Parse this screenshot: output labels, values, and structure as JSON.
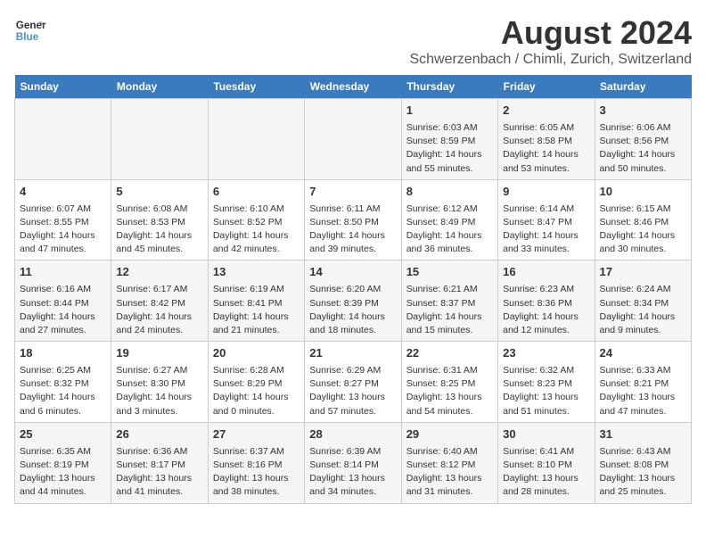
{
  "logo": {
    "line1": "General",
    "line2": "Blue"
  },
  "title": "August 2024",
  "subtitle": "Schwerzenbach / Chimli, Zurich, Switzerland",
  "days_of_week": [
    "Sunday",
    "Monday",
    "Tuesday",
    "Wednesday",
    "Thursday",
    "Friday",
    "Saturday"
  ],
  "weeks": [
    [
      {
        "day": "",
        "content": ""
      },
      {
        "day": "",
        "content": ""
      },
      {
        "day": "",
        "content": ""
      },
      {
        "day": "",
        "content": ""
      },
      {
        "day": "1",
        "content": "Sunrise: 6:03 AM\nSunset: 8:59 PM\nDaylight: 14 hours\nand 55 minutes."
      },
      {
        "day": "2",
        "content": "Sunrise: 6:05 AM\nSunset: 8:58 PM\nDaylight: 14 hours\nand 53 minutes."
      },
      {
        "day": "3",
        "content": "Sunrise: 6:06 AM\nSunset: 8:56 PM\nDaylight: 14 hours\nand 50 minutes."
      }
    ],
    [
      {
        "day": "4",
        "content": "Sunrise: 6:07 AM\nSunset: 8:55 PM\nDaylight: 14 hours\nand 47 minutes."
      },
      {
        "day": "5",
        "content": "Sunrise: 6:08 AM\nSunset: 8:53 PM\nDaylight: 14 hours\nand 45 minutes."
      },
      {
        "day": "6",
        "content": "Sunrise: 6:10 AM\nSunset: 8:52 PM\nDaylight: 14 hours\nand 42 minutes."
      },
      {
        "day": "7",
        "content": "Sunrise: 6:11 AM\nSunset: 8:50 PM\nDaylight: 14 hours\nand 39 minutes."
      },
      {
        "day": "8",
        "content": "Sunrise: 6:12 AM\nSunset: 8:49 PM\nDaylight: 14 hours\nand 36 minutes."
      },
      {
        "day": "9",
        "content": "Sunrise: 6:14 AM\nSunset: 8:47 PM\nDaylight: 14 hours\nand 33 minutes."
      },
      {
        "day": "10",
        "content": "Sunrise: 6:15 AM\nSunset: 8:46 PM\nDaylight: 14 hours\nand 30 minutes."
      }
    ],
    [
      {
        "day": "11",
        "content": "Sunrise: 6:16 AM\nSunset: 8:44 PM\nDaylight: 14 hours\nand 27 minutes."
      },
      {
        "day": "12",
        "content": "Sunrise: 6:17 AM\nSunset: 8:42 PM\nDaylight: 14 hours\nand 24 minutes."
      },
      {
        "day": "13",
        "content": "Sunrise: 6:19 AM\nSunset: 8:41 PM\nDaylight: 14 hours\nand 21 minutes."
      },
      {
        "day": "14",
        "content": "Sunrise: 6:20 AM\nSunset: 8:39 PM\nDaylight: 14 hours\nand 18 minutes."
      },
      {
        "day": "15",
        "content": "Sunrise: 6:21 AM\nSunset: 8:37 PM\nDaylight: 14 hours\nand 15 minutes."
      },
      {
        "day": "16",
        "content": "Sunrise: 6:23 AM\nSunset: 8:36 PM\nDaylight: 14 hours\nand 12 minutes."
      },
      {
        "day": "17",
        "content": "Sunrise: 6:24 AM\nSunset: 8:34 PM\nDaylight: 14 hours\nand 9 minutes."
      }
    ],
    [
      {
        "day": "18",
        "content": "Sunrise: 6:25 AM\nSunset: 8:32 PM\nDaylight: 14 hours\nand 6 minutes."
      },
      {
        "day": "19",
        "content": "Sunrise: 6:27 AM\nSunset: 8:30 PM\nDaylight: 14 hours\nand 3 minutes."
      },
      {
        "day": "20",
        "content": "Sunrise: 6:28 AM\nSunset: 8:29 PM\nDaylight: 14 hours\nand 0 minutes."
      },
      {
        "day": "21",
        "content": "Sunrise: 6:29 AM\nSunset: 8:27 PM\nDaylight: 13 hours\nand 57 minutes."
      },
      {
        "day": "22",
        "content": "Sunrise: 6:31 AM\nSunset: 8:25 PM\nDaylight: 13 hours\nand 54 minutes."
      },
      {
        "day": "23",
        "content": "Sunrise: 6:32 AM\nSunset: 8:23 PM\nDaylight: 13 hours\nand 51 minutes."
      },
      {
        "day": "24",
        "content": "Sunrise: 6:33 AM\nSunset: 8:21 PM\nDaylight: 13 hours\nand 47 minutes."
      }
    ],
    [
      {
        "day": "25",
        "content": "Sunrise: 6:35 AM\nSunset: 8:19 PM\nDaylight: 13 hours\nand 44 minutes."
      },
      {
        "day": "26",
        "content": "Sunrise: 6:36 AM\nSunset: 8:17 PM\nDaylight: 13 hours\nand 41 minutes."
      },
      {
        "day": "27",
        "content": "Sunrise: 6:37 AM\nSunset: 8:16 PM\nDaylight: 13 hours\nand 38 minutes."
      },
      {
        "day": "28",
        "content": "Sunrise: 6:39 AM\nSunset: 8:14 PM\nDaylight: 13 hours\nand 34 minutes."
      },
      {
        "day": "29",
        "content": "Sunrise: 6:40 AM\nSunset: 8:12 PM\nDaylight: 13 hours\nand 31 minutes."
      },
      {
        "day": "30",
        "content": "Sunrise: 6:41 AM\nSunset: 8:10 PM\nDaylight: 13 hours\nand 28 minutes."
      },
      {
        "day": "31",
        "content": "Sunrise: 6:43 AM\nSunset: 8:08 PM\nDaylight: 13 hours\nand 25 minutes."
      }
    ]
  ]
}
